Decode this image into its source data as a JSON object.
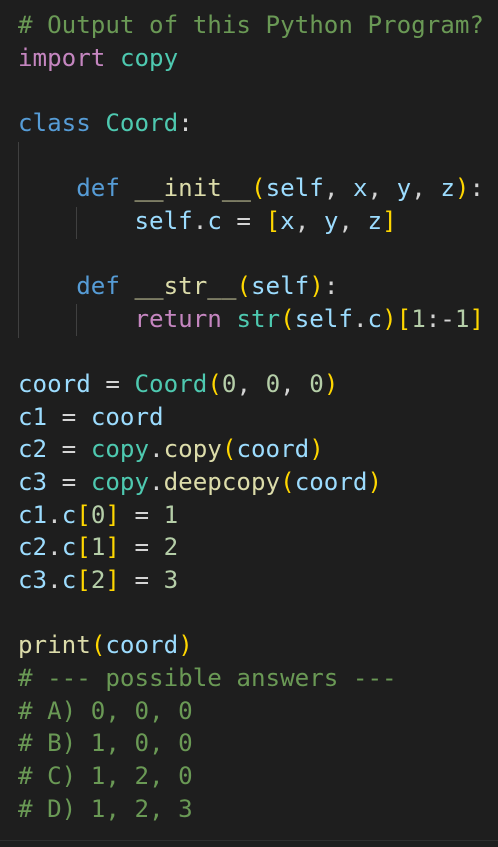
{
  "editor": {
    "theme": {
      "background": "#1e1e1e",
      "default": "#d4d4d4",
      "comment": "#6a9955",
      "keyword_import": "#c586c0",
      "keyword_def": "#569cd6",
      "class_name": "#4ec9b0",
      "function": "#dcdcaa",
      "variable": "#9cdcfe",
      "number": "#b5cea8",
      "bracket": "#ffd700"
    },
    "lines": [
      [
        {
          "t": "# Output of this Python Program?",
          "c": "comment"
        }
      ],
      [
        {
          "t": "import",
          "c": "keyword_import"
        },
        {
          "t": " ",
          "c": "default"
        },
        {
          "t": "copy",
          "c": "class_name"
        }
      ],
      [],
      [
        {
          "t": "class",
          "c": "keyword_def"
        },
        {
          "t": " ",
          "c": "default"
        },
        {
          "t": "Coord",
          "c": "class_name"
        },
        {
          "t": ":",
          "c": "default"
        }
      ],
      [],
      [
        {
          "t": "    ",
          "c": "default"
        },
        {
          "t": "def",
          "c": "keyword_def"
        },
        {
          "t": " ",
          "c": "default"
        },
        {
          "t": "__init__",
          "c": "function"
        },
        {
          "t": "(",
          "c": "bracket"
        },
        {
          "t": "self",
          "c": "variable"
        },
        {
          "t": ", ",
          "c": "default"
        },
        {
          "t": "x",
          "c": "variable"
        },
        {
          "t": ", ",
          "c": "default"
        },
        {
          "t": "y",
          "c": "variable"
        },
        {
          "t": ", ",
          "c": "default"
        },
        {
          "t": "z",
          "c": "variable"
        },
        {
          "t": ")",
          "c": "bracket"
        },
        {
          "t": ":",
          "c": "default"
        }
      ],
      [
        {
          "t": "        ",
          "c": "default"
        },
        {
          "t": "self",
          "c": "variable"
        },
        {
          "t": ".",
          "c": "default"
        },
        {
          "t": "c",
          "c": "variable"
        },
        {
          "t": " = ",
          "c": "default"
        },
        {
          "t": "[",
          "c": "bracket"
        },
        {
          "t": "x",
          "c": "variable"
        },
        {
          "t": ", ",
          "c": "default"
        },
        {
          "t": "y",
          "c": "variable"
        },
        {
          "t": ", ",
          "c": "default"
        },
        {
          "t": "z",
          "c": "variable"
        },
        {
          "t": "]",
          "c": "bracket"
        }
      ],
      [],
      [
        {
          "t": "    ",
          "c": "default"
        },
        {
          "t": "def",
          "c": "keyword_def"
        },
        {
          "t": " ",
          "c": "default"
        },
        {
          "t": "__str__",
          "c": "function"
        },
        {
          "t": "(",
          "c": "bracket"
        },
        {
          "t": "self",
          "c": "variable"
        },
        {
          "t": ")",
          "c": "bracket"
        },
        {
          "t": ":",
          "c": "default"
        }
      ],
      [
        {
          "t": "        ",
          "c": "default"
        },
        {
          "t": "return",
          "c": "keyword_import"
        },
        {
          "t": " ",
          "c": "default"
        },
        {
          "t": "str",
          "c": "class_name"
        },
        {
          "t": "(",
          "c": "bracket"
        },
        {
          "t": "self",
          "c": "variable"
        },
        {
          "t": ".",
          "c": "default"
        },
        {
          "t": "c",
          "c": "variable"
        },
        {
          "t": ")",
          "c": "bracket"
        },
        {
          "t": "[",
          "c": "bracket"
        },
        {
          "t": "1",
          "c": "number"
        },
        {
          "t": ":-",
          "c": "default"
        },
        {
          "t": "1",
          "c": "number"
        },
        {
          "t": "]",
          "c": "bracket"
        }
      ],
      [],
      [
        {
          "t": "coord",
          "c": "variable"
        },
        {
          "t": " = ",
          "c": "default"
        },
        {
          "t": "Coord",
          "c": "class_name"
        },
        {
          "t": "(",
          "c": "bracket"
        },
        {
          "t": "0",
          "c": "number"
        },
        {
          "t": ", ",
          "c": "default"
        },
        {
          "t": "0",
          "c": "number"
        },
        {
          "t": ", ",
          "c": "default"
        },
        {
          "t": "0",
          "c": "number"
        },
        {
          "t": ")",
          "c": "bracket"
        }
      ],
      [
        {
          "t": "c1",
          "c": "variable"
        },
        {
          "t": " = ",
          "c": "default"
        },
        {
          "t": "coord",
          "c": "variable"
        }
      ],
      [
        {
          "t": "c2",
          "c": "variable"
        },
        {
          "t": " = ",
          "c": "default"
        },
        {
          "t": "copy",
          "c": "class_name"
        },
        {
          "t": ".",
          "c": "default"
        },
        {
          "t": "copy",
          "c": "function"
        },
        {
          "t": "(",
          "c": "bracket"
        },
        {
          "t": "coord",
          "c": "variable"
        },
        {
          "t": ")",
          "c": "bracket"
        }
      ],
      [
        {
          "t": "c3",
          "c": "variable"
        },
        {
          "t": " = ",
          "c": "default"
        },
        {
          "t": "copy",
          "c": "class_name"
        },
        {
          "t": ".",
          "c": "default"
        },
        {
          "t": "deepcopy",
          "c": "function"
        },
        {
          "t": "(",
          "c": "bracket"
        },
        {
          "t": "coord",
          "c": "variable"
        },
        {
          "t": ")",
          "c": "bracket"
        }
      ],
      [
        {
          "t": "c1",
          "c": "variable"
        },
        {
          "t": ".",
          "c": "default"
        },
        {
          "t": "c",
          "c": "variable"
        },
        {
          "t": "[",
          "c": "bracket"
        },
        {
          "t": "0",
          "c": "number"
        },
        {
          "t": "]",
          "c": "bracket"
        },
        {
          "t": " = ",
          "c": "default"
        },
        {
          "t": "1",
          "c": "number"
        }
      ],
      [
        {
          "t": "c2",
          "c": "variable"
        },
        {
          "t": ".",
          "c": "default"
        },
        {
          "t": "c",
          "c": "variable"
        },
        {
          "t": "[",
          "c": "bracket"
        },
        {
          "t": "1",
          "c": "number"
        },
        {
          "t": "]",
          "c": "bracket"
        },
        {
          "t": " = ",
          "c": "default"
        },
        {
          "t": "2",
          "c": "number"
        }
      ],
      [
        {
          "t": "c3",
          "c": "variable"
        },
        {
          "t": ".",
          "c": "default"
        },
        {
          "t": "c",
          "c": "variable"
        },
        {
          "t": "[",
          "c": "bracket"
        },
        {
          "t": "2",
          "c": "number"
        },
        {
          "t": "]",
          "c": "bracket"
        },
        {
          "t": " = ",
          "c": "default"
        },
        {
          "t": "3",
          "c": "number"
        }
      ],
      [],
      [
        {
          "t": "print",
          "c": "function"
        },
        {
          "t": "(",
          "c": "bracket"
        },
        {
          "t": "coord",
          "c": "variable"
        },
        {
          "t": ")",
          "c": "bracket"
        }
      ],
      [
        {
          "t": "# --- possible answers ---",
          "c": "comment"
        }
      ],
      [
        {
          "t": "# A) 0, 0, 0",
          "c": "comment"
        }
      ],
      [
        {
          "t": "# B) 1, 0, 0",
          "c": "comment"
        }
      ],
      [
        {
          "t": "# C) 1, 2, 0",
          "c": "comment"
        }
      ],
      [
        {
          "t": "# D) 1, 2, 3",
          "c": "comment"
        }
      ]
    ]
  }
}
